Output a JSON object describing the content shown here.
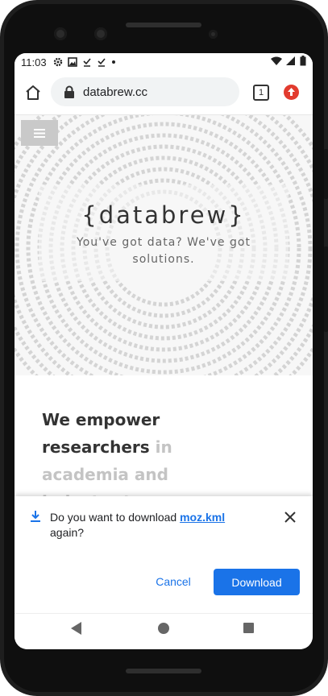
{
  "status_bar": {
    "time": "11:03",
    "left_icons": [
      "settings-icon",
      "image-icon",
      "download-done-icon",
      "download-done-icon",
      "dot-icon"
    ],
    "right_icons": [
      "wifi-icon",
      "signal-icon",
      "battery-icon"
    ]
  },
  "browser": {
    "url": "databrew.cc",
    "tab_count": "1"
  },
  "hero": {
    "title": "{databrew}",
    "subtitle": "You've got data? We've got solutions."
  },
  "content": {
    "tagline_dark": "We empower researchers",
    "tagline_light": " in academia and industry to"
  },
  "download_prompt": {
    "text_prefix": "Do you want to download ",
    "filename": "moz.kml",
    "text_suffix": " again?",
    "cancel_label": "Cancel",
    "download_label": "Download"
  },
  "colors": {
    "accent": "#1a73e8",
    "update_badge": "#e23b2e"
  }
}
